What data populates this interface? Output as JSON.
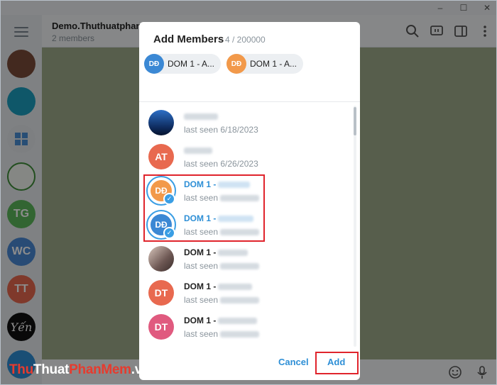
{
  "window": {
    "minimize": "–",
    "maximize": "☐",
    "close": "✕"
  },
  "rail": {
    "items": [
      {
        "initials": "",
        "color": "#7a4b3a"
      },
      {
        "initials": "",
        "color": "#1d9fbf"
      },
      {
        "initials": "",
        "color": "#4a8fd6"
      },
      {
        "initials": "",
        "color": "#3f8e3a"
      },
      {
        "initials": "TG",
        "color": "#5cb85c"
      },
      {
        "initials": "WC",
        "color": "#4a89d6"
      },
      {
        "initials": "TT",
        "color": "#e8694f"
      },
      {
        "initials": "Yến",
        "color": "#111111"
      },
      {
        "initials": "",
        "color": "#2e8fd6"
      }
    ]
  },
  "chat": {
    "title": "Demo.Thuthuatphanm",
    "subtitle": "2 members"
  },
  "dialog": {
    "title": "Add Members",
    "count": "4 / 200000",
    "chips": [
      {
        "initials": "DĐ",
        "label": "DOM 1 - A...",
        "color": "#3b88d4"
      },
      {
        "initials": "DĐ",
        "label": "DOM 1 - A...",
        "color": "#f2994a"
      }
    ],
    "members": [
      {
        "name": "",
        "status": "last seen 6/18/2023",
        "initials": "",
        "color": "#1e4a8a",
        "selected": false
      },
      {
        "name": "",
        "status": "last seen 6/26/2023",
        "initials": "AT",
        "color": "#e8694f",
        "selected": false
      },
      {
        "name": "DOM 1 -",
        "status": "last seen",
        "initials": "DĐ",
        "color": "#f2994a",
        "selected": true
      },
      {
        "name": "DOM 1 -",
        "status": "last seen",
        "initials": "DĐ",
        "color": "#3b88d4",
        "selected": true
      },
      {
        "name": "DOM 1 -",
        "status": "last seen",
        "initials": "",
        "color": "#7b6a66",
        "selected": false
      },
      {
        "name": "DOM 1 -",
        "status": "last seen",
        "initials": "DT",
        "color": "#e8694f",
        "selected": false
      },
      {
        "name": "DOM 1 -",
        "status": "last seen",
        "initials": "DT",
        "color": "#e05a7f",
        "selected": false
      }
    ],
    "cancel_label": "Cancel",
    "add_label": "Add"
  },
  "watermark": {
    "part1": "Thu",
    "part2": "Thuat",
    "part3": "PhanMem",
    "part4": ".vn"
  }
}
